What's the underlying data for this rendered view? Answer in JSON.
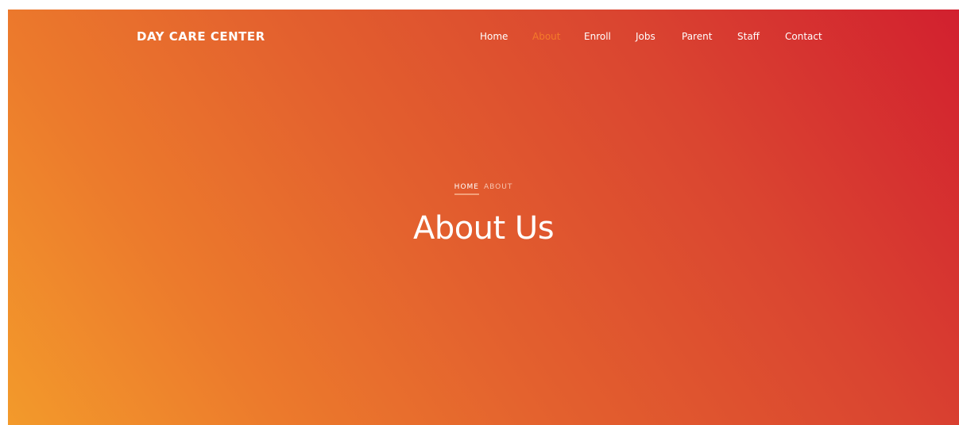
{
  "header": {
    "brand": "DAY CARE CENTER",
    "nav": [
      {
        "label": "Home",
        "active": false
      },
      {
        "label": "About",
        "active": true
      },
      {
        "label": "Enroll",
        "active": false
      },
      {
        "label": "Jobs",
        "active": false
      },
      {
        "label": "Parent",
        "active": false
      },
      {
        "label": "Staff",
        "active": false
      },
      {
        "label": "Contact",
        "active": false
      }
    ]
  },
  "hero": {
    "breadcrumb": {
      "home": "HOME",
      "current": "ABOUT"
    },
    "title": "About Us"
  },
  "colors": {
    "gradient_start": "#f39a2b",
    "gradient_end": "#d2202f",
    "active_nav": "#f47a2a"
  }
}
